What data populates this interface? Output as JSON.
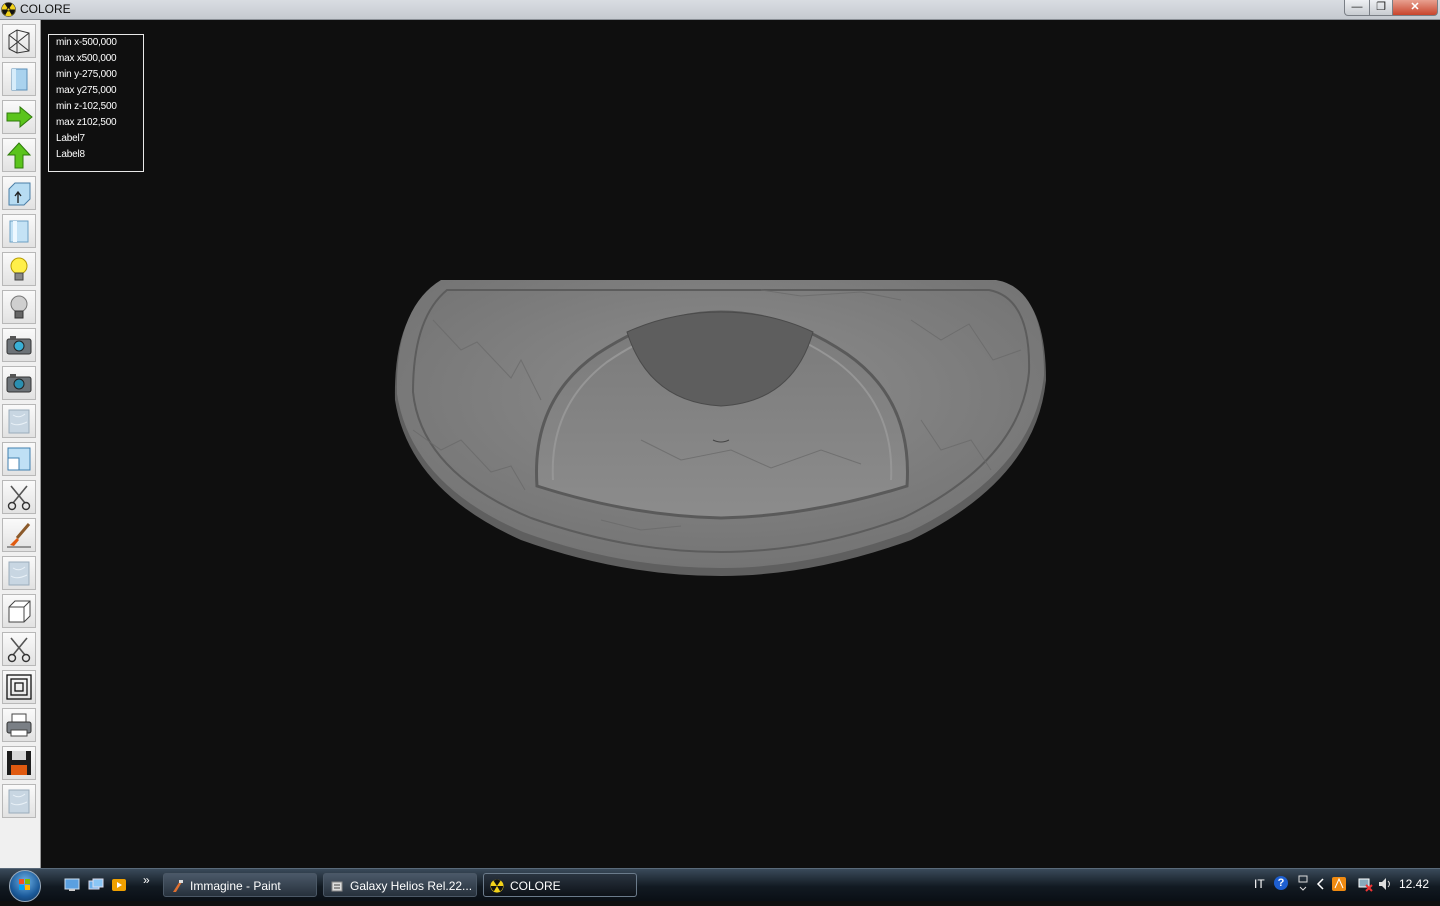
{
  "window": {
    "title": "COLORE",
    "controls": {
      "minimize": "—",
      "maximize": "❐",
      "close": "✕"
    }
  },
  "toolbar": {
    "tools": [
      {
        "name": "wireframe-view-icon"
      },
      {
        "name": "solid-view-icon"
      },
      {
        "name": "arrow-right-icon"
      },
      {
        "name": "arrow-up-icon"
      },
      {
        "name": "box-arrow-icon"
      },
      {
        "name": "glass-panel-icon"
      },
      {
        "name": "light-on-icon"
      },
      {
        "name": "light-off-icon"
      },
      {
        "name": "camera-icon"
      },
      {
        "name": "camera-alt-icon"
      },
      {
        "name": "texture-icon"
      },
      {
        "name": "window-layout-icon"
      },
      {
        "name": "scissors-icon"
      },
      {
        "name": "brush-icon"
      },
      {
        "name": "texture-alt-icon"
      },
      {
        "name": "cube-icon"
      },
      {
        "name": "scissors-alt-icon"
      },
      {
        "name": "concentric-squares-icon"
      },
      {
        "name": "printer-icon"
      },
      {
        "name": "save-disk-icon"
      },
      {
        "name": "texture-extra-icon"
      }
    ]
  },
  "info": {
    "lines": [
      "min x-500,000",
      "max x500,000",
      "min y-275,000",
      "max y275,000",
      "min z-102,500",
      "max z102,500",
      "Label7",
      "Label8"
    ]
  },
  "taskbar": {
    "quicklaunch_more": "»",
    "tasks": [
      {
        "label": "Immagine - Paint"
      },
      {
        "label": "Galaxy Helios  Rel.22..."
      },
      {
        "label": "COLORE"
      }
    ],
    "tray": {
      "language": "IT",
      "clock": "12.42",
      "help": "?"
    }
  },
  "colors": {
    "viewport_bg": "#0f0f0f",
    "marble": "#8a8a8a",
    "toolbar_bg": "#f0f0f0"
  }
}
